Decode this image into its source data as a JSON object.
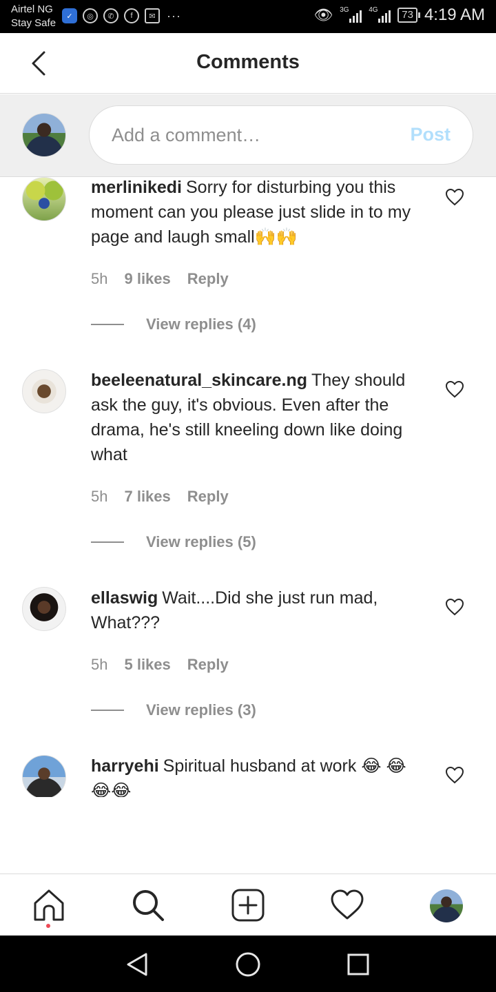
{
  "status_bar": {
    "carrier": "Airtel NG",
    "carrier_sub": "Stay Safe",
    "dots": "···",
    "network_1": "3G",
    "network_2": "4G",
    "battery": "73",
    "time": "4:19 AM"
  },
  "header": {
    "title": "Comments"
  },
  "composer": {
    "placeholder": "Add a comment…",
    "post_label": "Post",
    "post_color": "#b2dffc"
  },
  "comments": [
    {
      "username": "merlinikedi",
      "text": "Sorry for disturbing you this moment can you please just slide in to my page and laugh small🙌🙌",
      "time": "5h",
      "likes": "9 likes",
      "reply": "Reply",
      "view_replies": "View replies (4)"
    },
    {
      "username": "beeleenatural_skincare.ng",
      "text": "They should ask the guy, it's obvious. Even after the drama, he's still kneeling down like doing what",
      "time": "5h",
      "likes": "7 likes",
      "reply": "Reply",
      "view_replies": "View replies (5)"
    },
    {
      "username": "ellaswig",
      "text": "Wait....Did she just run mad, What???",
      "time": "5h",
      "likes": "5 likes",
      "reply": "Reply",
      "view_replies": "View replies (3)"
    },
    {
      "username": "harryehi",
      "text": "Spiritual husband at work 😂 😂😂😂"
    }
  ],
  "icons": {
    "back": "chevron-left-icon",
    "heart": "heart-outline-icon",
    "home": "home-icon",
    "search": "search-icon",
    "add": "add-post-icon",
    "activity": "heart-icon",
    "profile": "profile-avatar"
  },
  "colors": {
    "text": "#262626",
    "muted": "#8e8e8e",
    "notification_dot": "#ed4956"
  }
}
